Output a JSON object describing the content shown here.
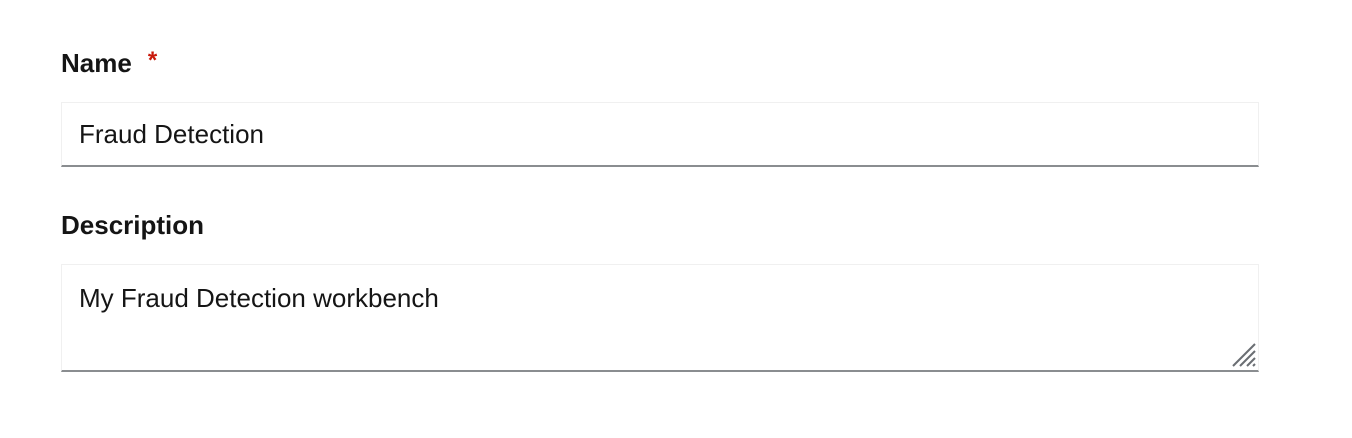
{
  "form": {
    "name": {
      "label": "Name",
      "required_marker": "*",
      "value": "Fraud Detection"
    },
    "description": {
      "label": "Description",
      "value": "My Fraud Detection workbench"
    }
  },
  "colors": {
    "required": "#c9190b",
    "input_border_bottom": "#8a8d90",
    "input_border": "#f0f0f0",
    "text": "#151515"
  },
  "icons": {
    "resize_handle": "resize-handle-icon"
  }
}
